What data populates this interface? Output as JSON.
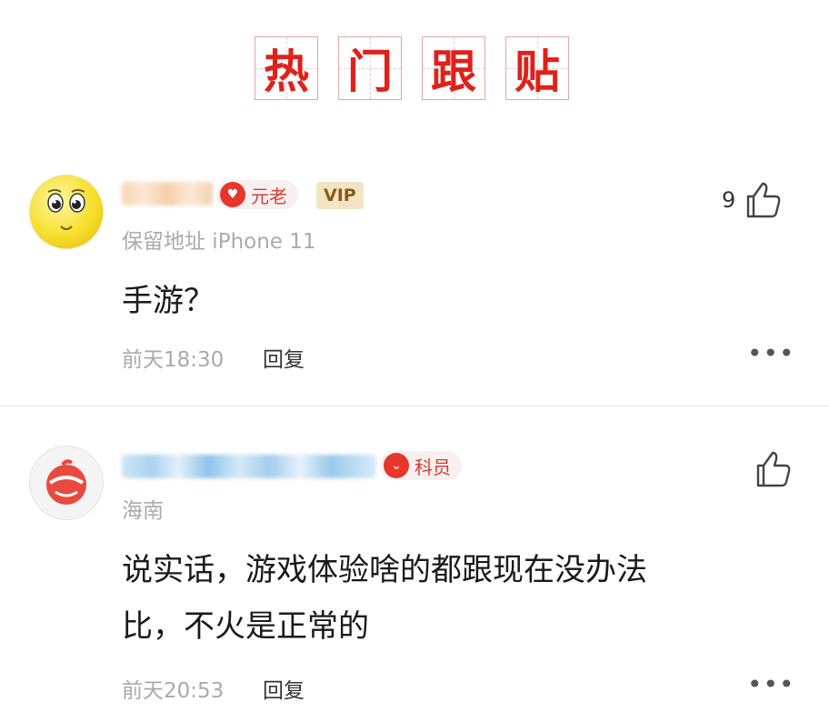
{
  "title": {
    "chars": [
      "热",
      "门",
      "跟",
      "贴"
    ]
  },
  "comments": [
    {
      "badge": "元老",
      "vip": "VIP",
      "meta": "保留地址  iPhone 11",
      "content": "手游？",
      "time": "前天18:30",
      "reply": "回复",
      "likes": "9",
      "more": "•••"
    },
    {
      "badge": "科员",
      "meta": "海南",
      "content_lines": [
        "说实话，游戏体验啥的都跟现在没办法",
        "比，不火是正常的"
      ],
      "time": "前天20:53",
      "reply": "回复",
      "likes": "",
      "more": "•••"
    }
  ],
  "colors": {
    "title_red": "#e0201a",
    "badge_red": "#e8362b",
    "vip_gold": "#f3e5c4"
  }
}
